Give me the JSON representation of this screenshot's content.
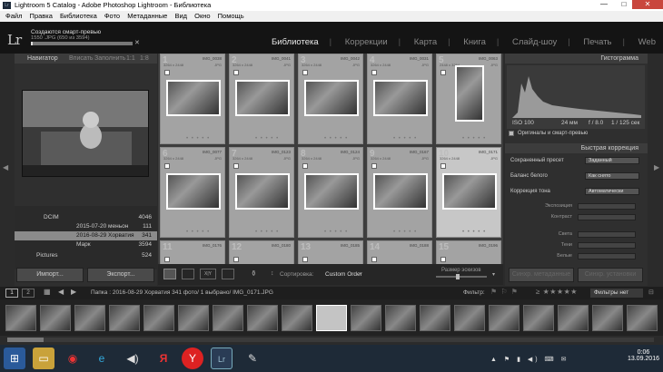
{
  "window": {
    "title": "Lightroom 5 Catalog - Adobe Photoshop Lightroom - Библиотека",
    "logo": "Lr"
  },
  "menu": [
    "Файл",
    "Правка",
    "Библиотека",
    "Фото",
    "Метаданные",
    "Вид",
    "Окно",
    "Помощь"
  ],
  "task": {
    "name": "Создаются смарт-превью",
    "file": "1550 .JPG (650 из 3594)"
  },
  "modules": [
    "Библиотека",
    "Коррекции",
    "Карта",
    "Книга",
    "Слайд-шоу",
    "Печать",
    "Web"
  ],
  "navigator": {
    "title": "Навигатор",
    "opts": [
      "Вписать",
      "Заполнить",
      "1:1",
      "1:8"
    ]
  },
  "folders": [
    {
      "name": "DCIM",
      "count": "4046"
    },
    {
      "name": "2015-07-20 меньон",
      "count": "111"
    },
    {
      "name": "2016-08-29 Хорватия",
      "count": "341"
    },
    {
      "name": "Марк",
      "count": "3594"
    },
    {
      "name": "Pictures",
      "count": "524"
    }
  ],
  "left_buttons": {
    "import": "Импорт...",
    "export": "Экспорт..."
  },
  "grid": [
    {
      "n": "1",
      "name": "IMG_0038",
      "dim": "3264 x 2448",
      "ext": "JPG"
    },
    {
      "n": "2",
      "name": "IMG_0041",
      "dim": "3264 x 2448",
      "ext": "JPG"
    },
    {
      "n": "3",
      "name": "IMG_0042",
      "dim": "3264 x 2448",
      "ext": "JPG"
    },
    {
      "n": "4",
      "name": "IMG_0031",
      "dim": "3264 x 2448",
      "ext": "JPG"
    },
    {
      "n": "5",
      "name": "IMG_0063",
      "dim": "2448 x 3264",
      "ext": "JPG"
    },
    {
      "n": "6",
      "name": "IMG_0077",
      "dim": "3264 x 2448",
      "ext": "JPG"
    },
    {
      "n": "7",
      "name": "IMG_0123",
      "dim": "3264 x 2448",
      "ext": "JPG"
    },
    {
      "n": "8",
      "name": "IMG_0124",
      "dim": "3264 x 2448",
      "ext": "JPG"
    },
    {
      "n": "9",
      "name": "IMG_0167",
      "dim": "3264 x 2448",
      "ext": "JPG"
    },
    {
      "n": "10",
      "name": "IMG_0171",
      "dim": "3264 x 2448",
      "ext": "JPG"
    },
    {
      "n": "11",
      "name": "IMG_0176",
      "dim": "",
      "ext": ""
    },
    {
      "n": "12",
      "name": "IMG_0180",
      "dim": "",
      "ext": ""
    },
    {
      "n": "13",
      "name": "IMG_0185",
      "dim": "",
      "ext": ""
    },
    {
      "n": "14",
      "name": "IMG_0188",
      "dim": "",
      "ext": ""
    },
    {
      "n": "15",
      "name": "IMG_0196",
      "dim": "",
      "ext": ""
    }
  ],
  "toolbar": {
    "sort_label": "Сортировка:",
    "sort_value": "Custom Order",
    "size_label": "Размер эскизов"
  },
  "histogram": {
    "title": "Гистограмма",
    "iso": "ISO 100",
    "focal": "24 мм",
    "aperture": "f / 8.0",
    "shutter": "1 / 125 сек",
    "originals": "Оригиналы и смарт-превью"
  },
  "quick": {
    "title": "Быстрая коррекция",
    "preset_label": "Сохраненный пресет",
    "preset_value": "Заданный",
    "wb_label": "Баланс белого",
    "wb_value": "Как снято",
    "tone_label": "Коррекция тона",
    "tone_value": "Автоматически",
    "tone_rows": [
      "Экспозиция",
      "Контраст",
      "Света",
      "Тени",
      "Белые"
    ]
  },
  "right_buttons": {
    "sync_meta": "Синхр. метаданные",
    "sync_settings": "Синхр. установки"
  },
  "filmbar": {
    "pages": [
      "1",
      "2"
    ],
    "path": "Папка : 2016-08-29 Хорватия  341 фото/  1 выбрано/  IMG_0171.JPG",
    "filter_label": "Фильтр:",
    "filter_value": "Фильтры нет"
  },
  "taskbar": {
    "time": "0:06",
    "date": "13.09.2016"
  }
}
